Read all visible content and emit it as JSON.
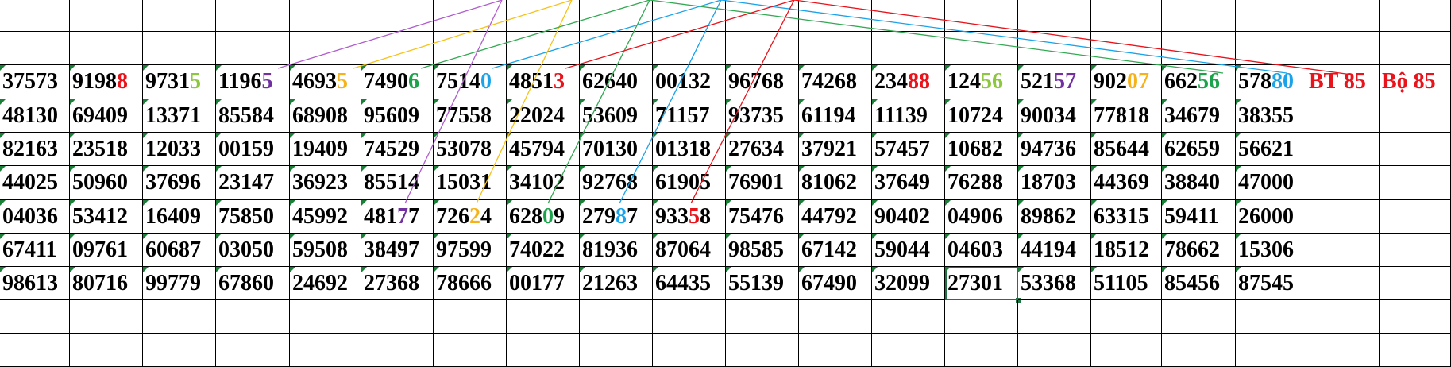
{
  "rows": [
    [
      "37573",
      "91988",
      "97315",
      "11965",
      "46935",
      "74906",
      "75140",
      "48513",
      "62640",
      "00132",
      "96768",
      "74268",
      "23488",
      "12456",
      "52157",
      "90207",
      "66256",
      "57880",
      "BT 85",
      "Bộ 85"
    ],
    [
      "48130",
      "69409",
      "13371",
      "85584",
      "68908",
      "95609",
      "77558",
      "22024",
      "53609",
      "71157",
      "93735",
      "61194",
      "11139",
      "10724",
      "90034",
      "77818",
      "34679",
      "38355",
      "",
      ""
    ],
    [
      "82163",
      "23518",
      "12033",
      "00159",
      "19409",
      "74529",
      "53078",
      "45794",
      "70130",
      "01318",
      "27634",
      "37921",
      "57457",
      "10682",
      "94736",
      "85644",
      "62659",
      "56621",
      "",
      ""
    ],
    [
      "44025",
      "50960",
      "37696",
      "23147",
      "36923",
      "85514",
      "15031",
      "34102",
      "92768",
      "61905",
      "76901",
      "81062",
      "37649",
      "76288",
      "18703",
      "44369",
      "38840",
      "47000",
      "",
      ""
    ],
    [
      "04036",
      "53412",
      "16409",
      "75850",
      "45992",
      "48177",
      "72624",
      "62809",
      "27987",
      "93358",
      "75476",
      "44792",
      "90402",
      "04906",
      "89862",
      "63315",
      "59411",
      "26000",
      "",
      ""
    ],
    [
      "67411",
      "09761",
      "60687",
      "03050",
      "59508",
      "38497",
      "97599",
      "74022",
      "81936",
      "87064",
      "98585",
      "67142",
      "59044",
      "04603",
      "44194",
      "18512",
      "78662",
      "15306",
      "",
      ""
    ],
    [
      "98613",
      "80716",
      "99779",
      "67860",
      "24692",
      "27368",
      "78666",
      "00177",
      "21263",
      "64435",
      "55139",
      "67490",
      "32099",
      "27301",
      "53368",
      "51105",
      "85456",
      "87545",
      "",
      ""
    ]
  ],
  "highlights": [
    {
      "row": 0,
      "col": 1,
      "start": 4,
      "len": 1,
      "color": "#e8131b"
    },
    {
      "row": 0,
      "col": 2,
      "start": 4,
      "len": 1,
      "color": "#8dc63f"
    },
    {
      "row": 0,
      "col": 3,
      "start": 4,
      "len": 1,
      "color": "#7030a0"
    },
    {
      "row": 0,
      "col": 4,
      "start": 4,
      "len": 1,
      "color": "#f6b21a"
    },
    {
      "row": 0,
      "col": 5,
      "start": 4,
      "len": 1,
      "color": "#1aa34a"
    },
    {
      "row": 0,
      "col": 6,
      "start": 4,
      "len": 1,
      "color": "#1aa3e8"
    },
    {
      "row": 0,
      "col": 7,
      "start": 4,
      "len": 1,
      "color": "#e8131b"
    },
    {
      "row": 0,
      "col": 12,
      "start": 3,
      "len": 2,
      "color": "#e8131b"
    },
    {
      "row": 0,
      "col": 13,
      "start": 3,
      "len": 2,
      "color": "#8dc63f"
    },
    {
      "row": 0,
      "col": 14,
      "start": 3,
      "len": 2,
      "color": "#7030a0"
    },
    {
      "row": 0,
      "col": 15,
      "start": 3,
      "len": 2,
      "color": "#f6b21a"
    },
    {
      "row": 0,
      "col": 16,
      "start": 3,
      "len": 2,
      "color": "#1aa34a"
    },
    {
      "row": 0,
      "col": 17,
      "start": 3,
      "len": 2,
      "color": "#1aa3e8"
    },
    {
      "row": 0,
      "col": 18,
      "start": 0,
      "len": 5,
      "color": "#e8131b"
    },
    {
      "row": 0,
      "col": 19,
      "start": 0,
      "len": 5,
      "color": "#e8131b"
    },
    {
      "row": 4,
      "col": 5,
      "start": 3,
      "len": 1,
      "color": "#7030a0"
    },
    {
      "row": 4,
      "col": 6,
      "start": 3,
      "len": 1,
      "color": "#f6b21a"
    },
    {
      "row": 4,
      "col": 7,
      "start": 3,
      "len": 1,
      "color": "#1aa34a"
    },
    {
      "row": 4,
      "col": 8,
      "start": 3,
      "len": 1,
      "color": "#1aa3e8"
    },
    {
      "row": 4,
      "col": 9,
      "start": 3,
      "len": 1,
      "color": "#e8131b"
    }
  ],
  "connector_colors": [
    "#b05ccf",
    "#f6c21a",
    "#34a853",
    "#1aa3e8",
    "#e8131b"
  ],
  "selected_cell": {
    "row": 8,
    "col": 13
  }
}
